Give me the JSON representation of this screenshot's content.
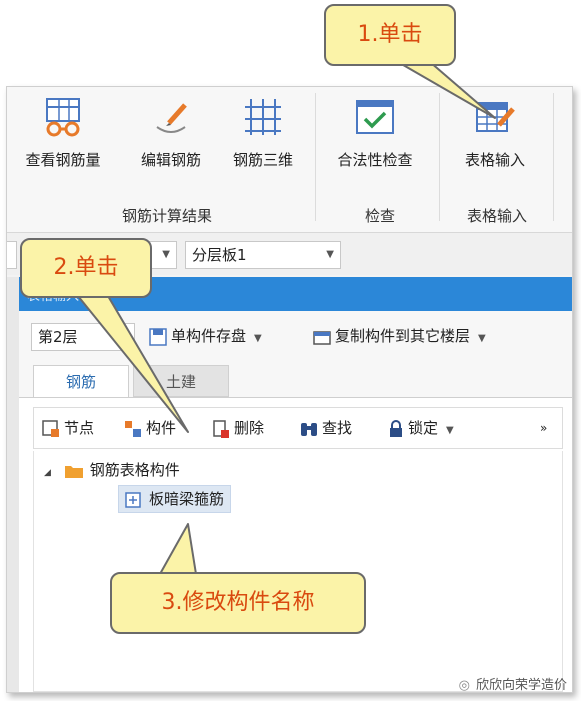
{
  "ribbon": {
    "buttons": [
      {
        "label": "查看钢筋量",
        "icon": "glasses-table-icon"
      },
      {
        "label": "编辑钢筋",
        "icon": "pencil-edit-icon"
      },
      {
        "label": "钢筋三维",
        "icon": "3d-grid-icon"
      },
      {
        "label": "合法性检查",
        "icon": "checkmark-window-icon"
      },
      {
        "label": "表格输入",
        "icon": "table-pencil-icon"
      }
    ],
    "groups": [
      "钢筋计算结果",
      "检查",
      "表格输入"
    ]
  },
  "combos": {
    "left_value": "",
    "middle_value": "",
    "layer_board": "分层板1"
  },
  "panel": {
    "title": "表格输入",
    "floor": "第2层",
    "save_single": "单构件存盘",
    "copy_to_floors": "复制构件到其它楼层",
    "tabs": [
      "钢筋",
      "土建"
    ],
    "tools": [
      "节点",
      "构件",
      "删除",
      "查找",
      "锁定"
    ],
    "tree_root": "钢筋表格构件",
    "tree_child": "板暗梁箍筋"
  },
  "callouts": [
    "1.单击",
    "2.单击",
    "3.修改构件名称"
  ],
  "watermark": "欣欣向荣学造价",
  "colors": {
    "accent": "#2b87d8",
    "callout_fill": "#fbf3a8",
    "callout_text": "#d94a0f"
  }
}
